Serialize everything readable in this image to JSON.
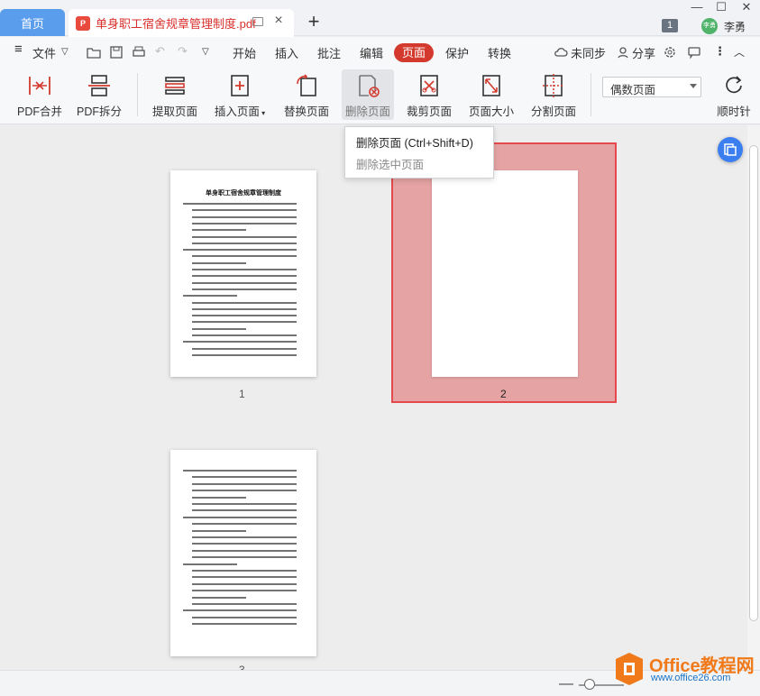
{
  "titlebar": {
    "home_tab": "首页",
    "doc_tab": "单身职工宿舍规章管理制度.pdf",
    "notification_count": "1",
    "user_name": "李勇",
    "avatar_text": "李勇"
  },
  "menubar": {
    "file": "文件",
    "tabs": [
      "开始",
      "插入",
      "批注",
      "编辑",
      "页面",
      "保护",
      "转换"
    ],
    "active_tab": "页面",
    "sync": "未同步",
    "share": "分享"
  },
  "ribbon": {
    "buttons": [
      {
        "label": "PDF合并",
        "icon": "merge-icon"
      },
      {
        "label": "PDF拆分",
        "icon": "split-icon"
      },
      {
        "label": "提取页面",
        "icon": "extract-icon"
      },
      {
        "label": "插入页面",
        "icon": "insert-page-icon"
      },
      {
        "label": "替换页面",
        "icon": "replace-icon"
      },
      {
        "label": "删除页面",
        "icon": "delete-page-icon"
      },
      {
        "label": "裁剪页面",
        "icon": "crop-icon"
      },
      {
        "label": "页面大小",
        "icon": "page-size-icon"
      },
      {
        "label": "分割页面",
        "icon": "divide-icon"
      },
      {
        "label": "顺时针",
        "icon": "rotate-icon"
      }
    ],
    "page_filter": "偶数页面"
  },
  "tooltip": {
    "title": "删除页面 (Ctrl+Shift+D)",
    "description": "删除选中页面"
  },
  "pages": [
    {
      "number": "1",
      "title": "单身职工宿舍规章管理制度",
      "selected": false
    },
    {
      "number": "2",
      "title": "",
      "selected": true
    },
    {
      "number": "3",
      "title": "",
      "selected": false
    }
  ],
  "watermark": {
    "line1": "Office教程网",
    "line2": "www.office26.com"
  },
  "colors": {
    "accent": "#d33a2d",
    "home_tab": "#5b9ded",
    "selection": "#e5484d"
  }
}
